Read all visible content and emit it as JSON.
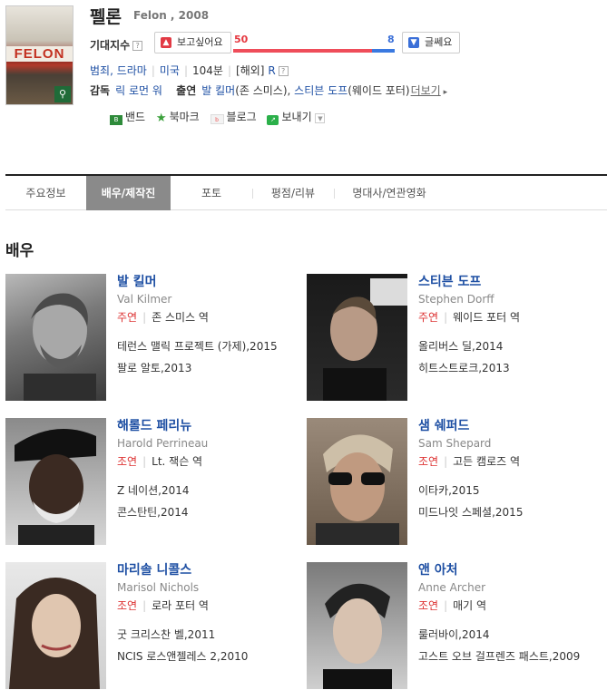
{
  "movie": {
    "title": "펠론",
    "subtitle": "Felon , 2008",
    "poster_title": "FELON"
  },
  "expectation": {
    "label": "기대지수",
    "help": "?",
    "want_label": "보고싶어요",
    "want_count": "50",
    "notwant_label": "글쎄요",
    "notwant_count": "8",
    "want_ratio": 0.86
  },
  "meta": {
    "genres": "범죄, 드라마",
    "country": "미국",
    "runtime": "104분",
    "rating_prefix": "[해외]",
    "rating": "R",
    "help": "?",
    "director_label": "감독",
    "director": "릭 로먼 워",
    "cast_label": "출연",
    "cast1": "발 킬머",
    "cast1_role": "(존 스미스),",
    "cast2": "스티븐 도프",
    "cast2_role": "(웨이드 포터)",
    "more": "더보기"
  },
  "share": {
    "band": "밴드",
    "bookmark": "북마크",
    "blog": "블로그",
    "send": "보내기"
  },
  "tabs": [
    {
      "label": "주요정보"
    },
    {
      "label": "배우/제작진"
    },
    {
      "label": "포토"
    },
    {
      "label": "평점/리뷰"
    },
    {
      "label": "명대사/연관영화"
    }
  ],
  "section_title": "배우",
  "cast": [
    {
      "kname": "발 킬머",
      "ename": "Val Kilmer",
      "type": "주연",
      "role": "존 스미스 역",
      "works": [
        "테런스 맬릭 프로젝트 (가제),2015",
        "팔로 알토,2013"
      ]
    },
    {
      "kname": "스티븐 도프",
      "ename": "Stephen Dorff",
      "type": "주연",
      "role": "웨이드 포터 역",
      "works": [
        "올리버스 딜,2014",
        "히트스트로크,2013"
      ]
    },
    {
      "kname": "해롤드 페리뉴",
      "ename": "Harold Perrineau",
      "type": "조연",
      "role": "Lt. 잭슨 역",
      "works": [
        "Z 네이션,2014",
        "콘스탄틴,2014"
      ]
    },
    {
      "kname": "샘 쉐퍼드",
      "ename": "Sam Shepard",
      "type": "조연",
      "role": "고든 캠로즈 역",
      "works": [
        "이타카,2015",
        "미드나잇 스페셜,2015"
      ]
    },
    {
      "kname": "마리솔 니콜스",
      "ename": "Marisol Nichols",
      "type": "조연",
      "role": "로라 포터 역",
      "works": [
        "굿 크리스찬 벨,2011",
        "NCIS 로스앤젤레스 2,2010"
      ]
    },
    {
      "kname": "앤 아처",
      "ename": "Anne Archer",
      "type": "조연",
      "role": "매기 역",
      "works": [
        "룰러바이,2014",
        "고스트 오브 걸프렌즈 패스트,2009"
      ]
    }
  ],
  "colors": {
    "link": "#1e4fa3",
    "want": "#ef4d5a",
    "notwant": "#3a79e0",
    "role_type": "#dd3333",
    "active_tab": "#8a8a8a"
  }
}
